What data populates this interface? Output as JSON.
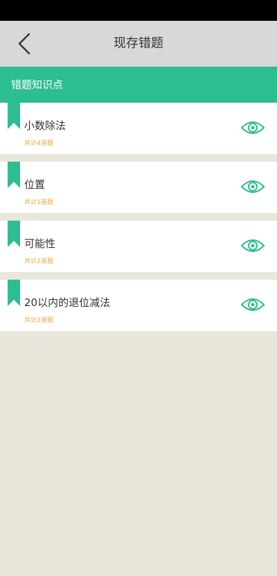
{
  "header": {
    "title": "现存错题",
    "back_icon": "chevron-left-icon"
  },
  "section": {
    "title": "错题知识点"
  },
  "colors": {
    "accent": "#2dbd92",
    "count_text": "#e8a33c",
    "background": "#e9e6dc"
  },
  "items": [
    {
      "title": "小数除法",
      "count": "共计4道题"
    },
    {
      "title": "位置",
      "count": "共计1道题"
    },
    {
      "title": "可能性",
      "count": "共计2道题"
    },
    {
      "title": "20以内的退位减法",
      "count": "共计2道题"
    }
  ]
}
